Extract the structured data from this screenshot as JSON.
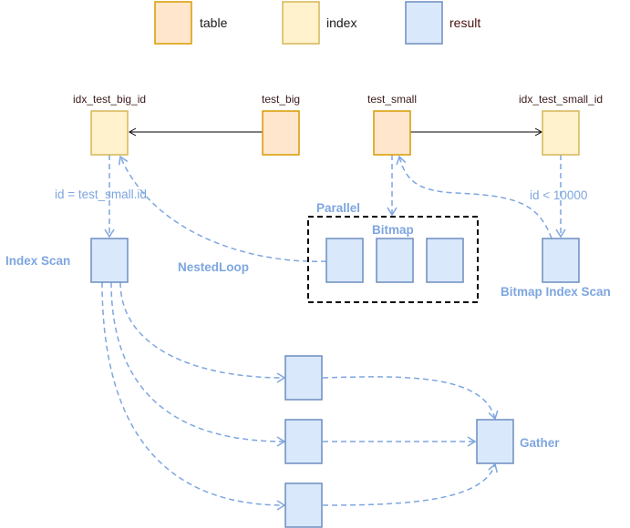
{
  "colors": {
    "table_fill": "#ffe6cc",
    "table_stroke": "#d79b00",
    "index_fill": "#fff2cc",
    "index_stroke": "#d6b656",
    "result_fill": "#dae8fc",
    "result_stroke": "#6c8ebf",
    "edge_blue": "#7ea6e0",
    "edge_black": "#000000"
  },
  "legend": [
    {
      "kind": "table",
      "label": "table"
    },
    {
      "kind": "index",
      "label": "index"
    },
    {
      "kind": "result",
      "label": "result"
    }
  ],
  "nodes": {
    "idx_test_big_id": {
      "label": "idx_test_big_id",
      "kind": "index"
    },
    "test_big": {
      "label": "test_big",
      "kind": "table"
    },
    "test_small": {
      "label": "test_small",
      "kind": "table"
    },
    "idx_test_small_id": {
      "label": "idx_test_small_id",
      "kind": "index"
    },
    "index_scan": {
      "label": "Index Scan",
      "kind": "result"
    },
    "bitmap_index_scan": {
      "label": "Bitmap Index Scan",
      "kind": "result"
    },
    "gather": {
      "label": "Gather",
      "kind": "result"
    }
  },
  "group": {
    "parallel_label": "Parallel",
    "bitmap_label": "Bitmap"
  },
  "edge_labels": {
    "id_eq": "id = test_small.id",
    "id_lt": "id < 10000",
    "nested_loop": "NestedLoop"
  }
}
